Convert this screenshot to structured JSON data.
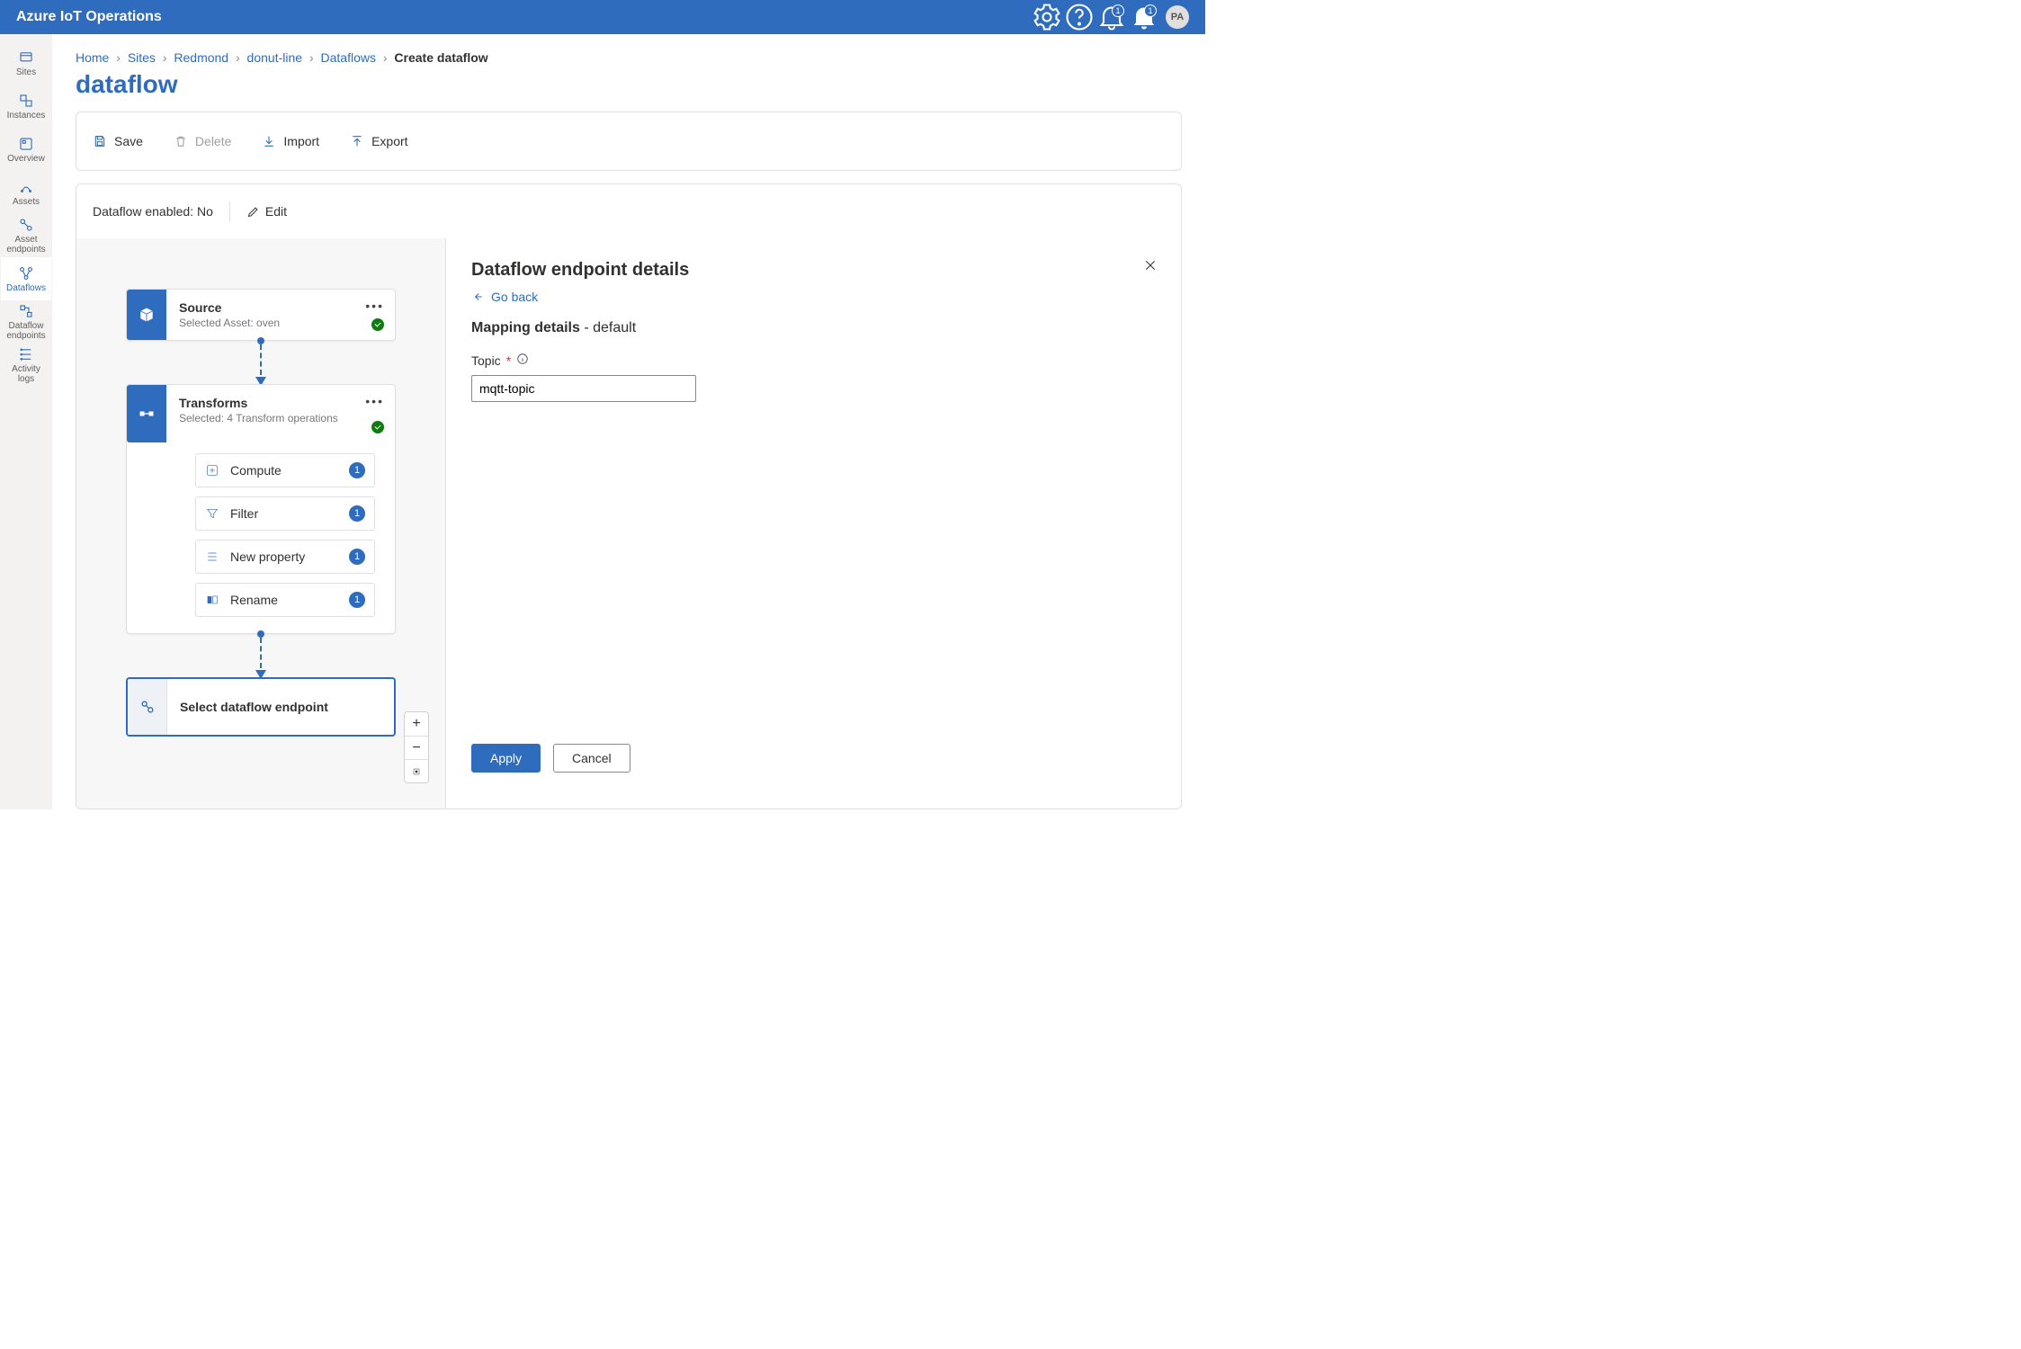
{
  "brand": "Azure IoT Operations",
  "topbar": {
    "notif1_badge": "1",
    "notif2_badge": "1",
    "avatar_initials": "PA"
  },
  "sidenav": {
    "items": [
      {
        "label": "Sites"
      },
      {
        "label": "Instances"
      },
      {
        "label": "Overview"
      },
      {
        "label": "Assets"
      },
      {
        "label": "Asset endpoints"
      },
      {
        "label": "Dataflows"
      },
      {
        "label": "Dataflow endpoints"
      },
      {
        "label": "Activity logs"
      }
    ]
  },
  "breadcrumb": {
    "home": "Home",
    "sites": "Sites",
    "site": "Redmond",
    "instance": "donut-line",
    "section": "Dataflows",
    "current": "Create dataflow"
  },
  "page_title": "dataflow",
  "toolbar": {
    "save": "Save",
    "delete": "Delete",
    "import": "Import",
    "export": "Export"
  },
  "statusbar": {
    "enabled_label": "Dataflow enabled: No",
    "edit": "Edit"
  },
  "canvas": {
    "source": {
      "title": "Source",
      "subtitle": "Selected Asset: oven"
    },
    "transforms": {
      "title": "Transforms",
      "subtitle": "Selected: 4 Transform operations",
      "ops": [
        {
          "label": "Compute",
          "count": "1"
        },
        {
          "label": "Filter",
          "count": "1"
        },
        {
          "label": "New property",
          "count": "1"
        },
        {
          "label": "Rename",
          "count": "1"
        }
      ]
    },
    "select_endpoint": "Select dataflow endpoint",
    "zoom": {
      "in": "+",
      "out": "−"
    }
  },
  "details": {
    "heading": "Dataflow endpoint details",
    "go_back": "Go back",
    "section_label": "Mapping details",
    "section_value": "default",
    "topic_label": "Topic",
    "topic_value": "mqtt-topic",
    "apply": "Apply",
    "cancel": "Cancel"
  }
}
